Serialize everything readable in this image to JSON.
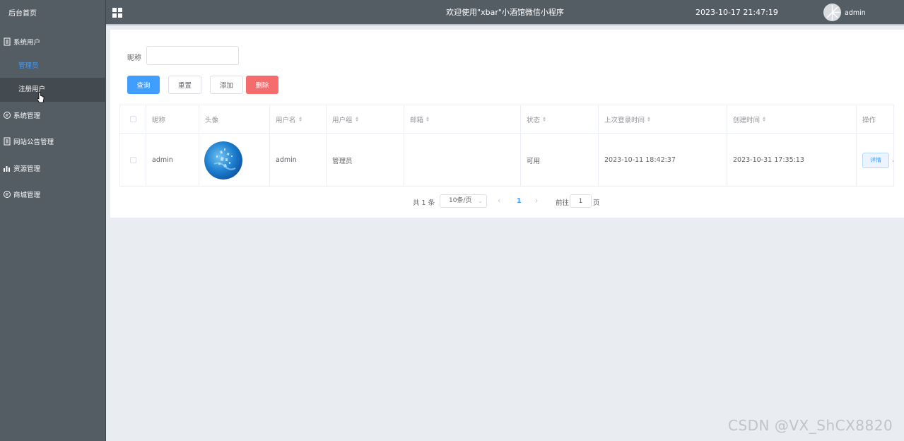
{
  "sidebar": {
    "home": "后台首页",
    "groups": [
      {
        "label": "系统用户",
        "icon": "document-icon"
      },
      {
        "label": "系统管理",
        "icon": "chat-icon"
      },
      {
        "label": "网站公告管理",
        "icon": "document-icon"
      },
      {
        "label": "资源管理",
        "icon": "bar-chart-icon"
      },
      {
        "label": "商城管理",
        "icon": "chat-icon"
      }
    ],
    "sub_items": [
      "管理员",
      "注册用户"
    ],
    "active_color": "#409eff"
  },
  "header": {
    "title": "欢迎使用\"xbar\"小酒馆微信小程序",
    "time": "2023-10-17 21:47:19",
    "username": "admin"
  },
  "filter": {
    "label": "昵称",
    "value": "",
    "buttons": {
      "search": "查询",
      "reset": "重置",
      "add": "添加",
      "delete": "删除"
    }
  },
  "table": {
    "columns": [
      "昵称",
      "头像",
      "用户名",
      "用户组",
      "邮箱",
      "状态",
      "上次登录时间",
      "创建时间",
      "操作"
    ],
    "rows": [
      {
        "nickname": "admin",
        "username": "admin",
        "group": "管理员",
        "email": "",
        "status": "可用",
        "last_login": "2023-10-11 18:42:37",
        "created": "2023-10-31 17:35:13",
        "action": "详情"
      }
    ]
  },
  "pagination": {
    "total": "共 1 条",
    "page_size": "10条/页",
    "current_page": "1",
    "goto_label": "前往",
    "goto_value": "1",
    "page_suffix": "页"
  },
  "watermark": "CSDN @VX_ShCX8820",
  "colors": {
    "primary": "#409eff",
    "danger": "#f56c6c",
    "sidebar": "#545c64"
  }
}
